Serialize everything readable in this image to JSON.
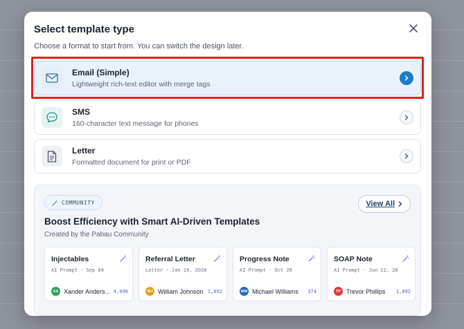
{
  "modal": {
    "title": "Select template type",
    "subtitle": "Choose a format to start from. You can switch the design later."
  },
  "options": [
    {
      "title": "Email (Simple)",
      "desc": "Lightweight rich-text editor with merge tags",
      "icon": "mail-icon",
      "selected": true
    },
    {
      "title": "SMS",
      "desc": "160-character text message for phones",
      "icon": "chat-bubble-icon",
      "selected": false
    },
    {
      "title": "Letter",
      "desc": "Formatted document for print or PDF",
      "icon": "document-icon",
      "selected": false
    }
  ],
  "community": {
    "badge": "COMMUNITY",
    "view_all": "View All",
    "title": "Boost Efficiency with Smart AI-Driven Templates",
    "subtitle": "Created by the Pabau Community",
    "cards": [
      {
        "title": "Injectables",
        "meta": "AI Prompt · Sep 04",
        "initials": "XA",
        "avatar_color": "#2e9e5b",
        "author": "Xander Anders…",
        "count": "4,096"
      },
      {
        "title": "Referral Letter",
        "meta": "Letter · Jan 19, 2020",
        "initials": "WJ",
        "avatar_color": "#e0a21b",
        "author": "William Johnson",
        "count": "1,092"
      },
      {
        "title": "Progress Note",
        "meta": "AI Prompt · Oct 26",
        "initials": "MW",
        "avatar_color": "#2466b4",
        "author": "Michael Williams",
        "count": "374"
      },
      {
        "title": "SOAP Note",
        "meta": "AI Prompt · Jun 11, 20",
        "initials": "TP",
        "avatar_color": "#d93a3a",
        "author": "Trevor Phillips",
        "count": "1,092"
      }
    ]
  },
  "colors": {
    "accent": "#1f7ac8",
    "highlight": "#e01e1e",
    "count": "#5c5fbf"
  }
}
